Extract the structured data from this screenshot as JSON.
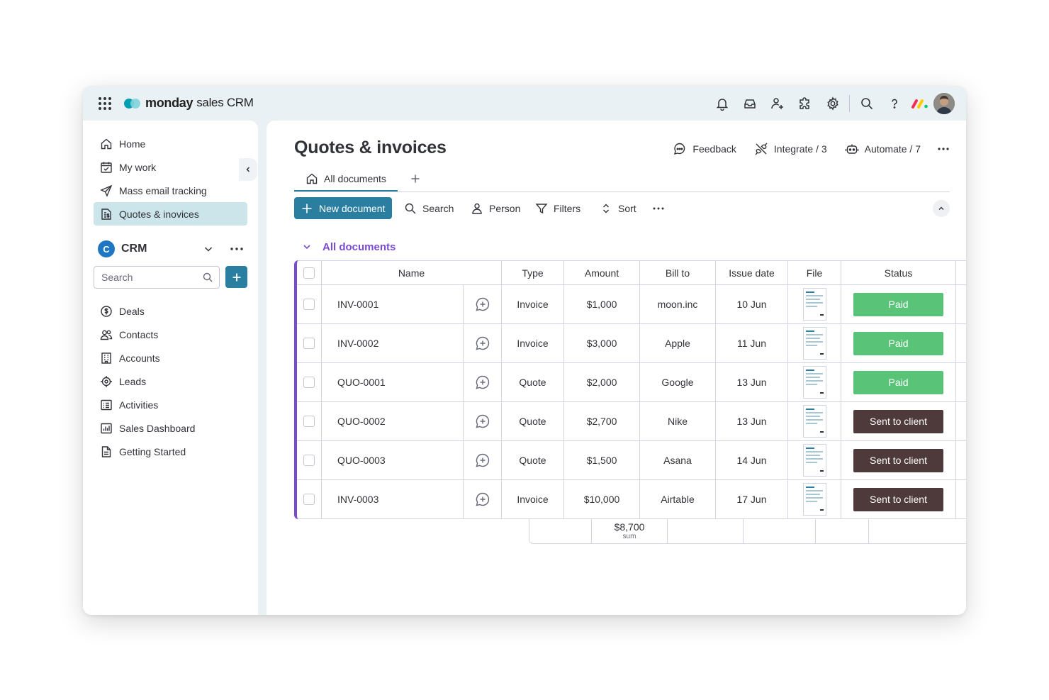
{
  "app": {
    "brand": "monday",
    "product": "sales CRM"
  },
  "sidebar": {
    "top_items": [
      {
        "label": "Home",
        "icon": "home-icon"
      },
      {
        "label": "My work",
        "icon": "calendar-check-icon"
      },
      {
        "label": "Mass email tracking",
        "icon": "send-icon"
      },
      {
        "label": "Quotes & inovices",
        "icon": "document-dollar-icon"
      }
    ],
    "workspace": {
      "initial": "C",
      "name": "CRM"
    },
    "search_placeholder": "Search",
    "items": [
      {
        "label": "Deals",
        "icon": "dollar-icon"
      },
      {
        "label": "Contacts",
        "icon": "people-icon"
      },
      {
        "label": "Accounts",
        "icon": "building-icon"
      },
      {
        "label": "Leads",
        "icon": "target-icon"
      },
      {
        "label": "Activities",
        "icon": "list-icon"
      },
      {
        "label": "Sales Dashboard",
        "icon": "chart-icon"
      },
      {
        "label": "Getting Started",
        "icon": "page-icon"
      }
    ]
  },
  "main": {
    "title": "Quotes & invoices",
    "actions": {
      "feedback": "Feedback",
      "integrate": "Integrate / 3",
      "automate": "Automate / 7"
    },
    "tab": "All documents",
    "toolbar": {
      "new_document": "New document",
      "search": "Search",
      "person": "Person",
      "filters": "Filters",
      "sort": "Sort"
    },
    "group_title": "All documents",
    "columns": {
      "name": "Name",
      "type": "Type",
      "amount": "Amount",
      "bill_to": "Bill to",
      "issue_date": "Issue date",
      "file": "File",
      "status": "Status"
    },
    "rows": [
      {
        "name": "INV-0001",
        "type": "Invoice",
        "amount": "$1,000",
        "bill_to": "moon.inc",
        "issue_date": "10 Jun",
        "status": "Paid"
      },
      {
        "name": "INV-0002",
        "type": "Invoice",
        "amount": "$3,000",
        "bill_to": "Apple",
        "issue_date": "11 Jun",
        "status": "Paid"
      },
      {
        "name": "QUO-0001",
        "type": "Quote",
        "amount": "$2,000",
        "bill_to": "Google",
        "issue_date": "13 Jun",
        "status": "Paid"
      },
      {
        "name": "QUO-0002",
        "type": "Quote",
        "amount": "$2,700",
        "bill_to": "Nike",
        "issue_date": "13 Jun",
        "status": "Sent to client"
      },
      {
        "name": "QUO-0003",
        "type": "Quote",
        "amount": "$1,500",
        "bill_to": "Asana",
        "issue_date": "14 Jun",
        "status": "Sent to client"
      },
      {
        "name": "INV-0003",
        "type": "Invoice",
        "amount": "$10,000",
        "bill_to": "Airtable",
        "issue_date": "17 Jun",
        "status": "Sent to client"
      }
    ],
    "summary": {
      "amount": "$8,700",
      "label": "sum"
    }
  },
  "colors": {
    "accent": "#2a7ea0",
    "group": "#784bd1",
    "status_paid": "#59c378",
    "status_sent": "#4e3a3a",
    "sidebar_active": "#cce5eb"
  }
}
